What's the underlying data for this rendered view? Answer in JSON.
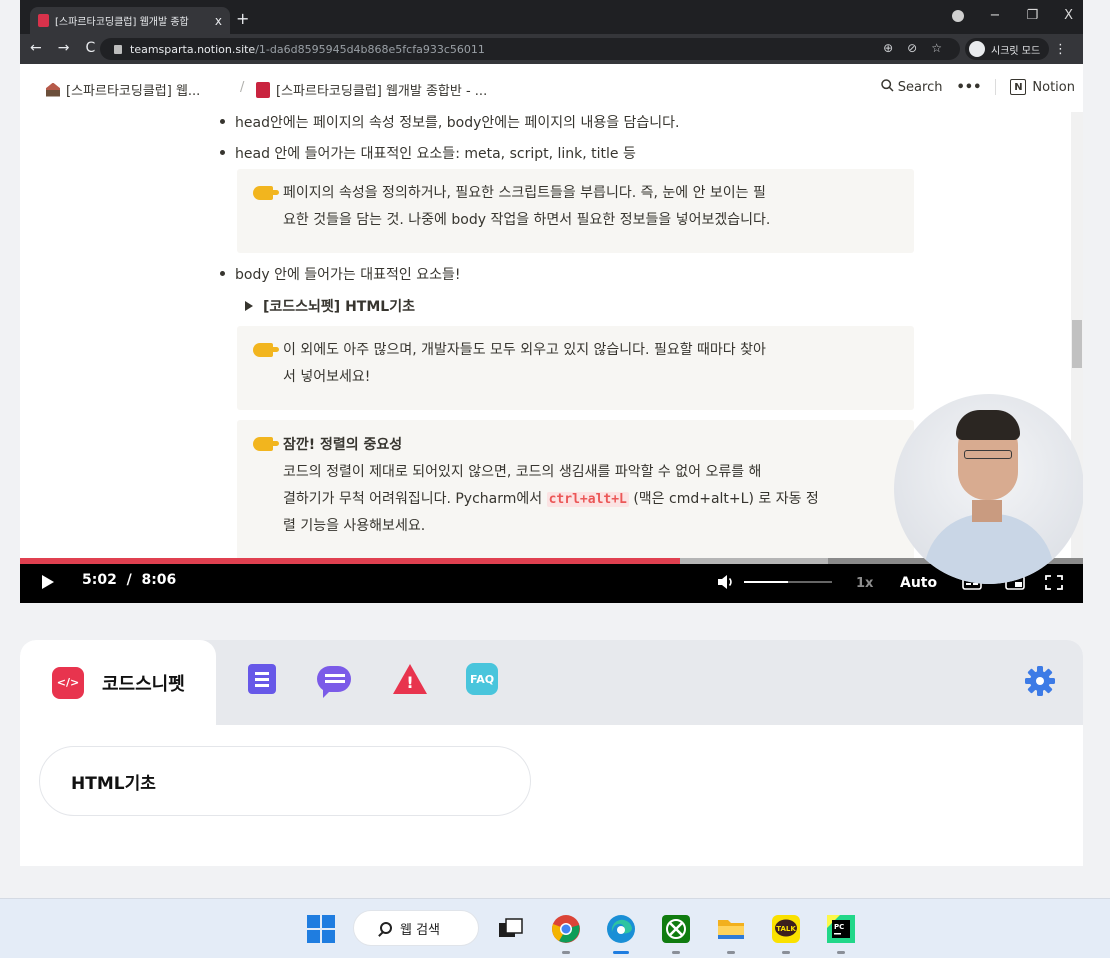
{
  "browser": {
    "tab_title": "[스파르타코딩클럽] 웹개발 종합",
    "tab_close": "x",
    "new_tab": "+",
    "url_host": "teamsparta.notion.site",
    "url_path": "/1-da6d8595945d4b868e5fcfa933c56011",
    "incognito_label": "시크릿 모드",
    "min": "−",
    "restore": "❐",
    "close": "X",
    "back": "←",
    "forward": "→",
    "reload": "C",
    "star": "☆",
    "menu": "⋮"
  },
  "notion": {
    "breadcrumb_1": "[스파르타코딩클럽] 웹...",
    "breadcrumb_sep": "/",
    "breadcrumb_2": "[스파르타코딩클럽] 웹개발 종합반 - ...",
    "search_label": "Search",
    "more": "•••",
    "brand": "Notion",
    "logo_letter": "N"
  },
  "content": {
    "bullet_1": "head안에는 페이지의 속성 정보를, body안에는 페이지의 내용을 담습니다.",
    "bullet_2": "head 안에 들어가는 대표적인 요소들: meta, script, link, title 등",
    "callout_1_line_1": "페이지의 속성을 정의하거나, 필요한 스크립트들을 부릅니다. 즉, 눈에 안 보이는 필",
    "callout_1_line_2": "요한 것들을 담는 것. 나중에 body 작업을 하면서 필요한 정보들을 넣어보겠습니다.",
    "bullet_3": "body 안에 들어가는 대표적인 요소들!",
    "toggle_label": "[코드스뇌펫] HTML기초",
    "callout_2_line_1": "이 외에도 아주 많으며, 개발자들도 모두 외우고 있지 않습니다. 필요할 때마다 찾아",
    "callout_2_line_2": "서 넣어보세요!",
    "callout_3_title": "잠깐! 정렬의 중요성",
    "callout_3_line_1": "코드의 정렬이 제대로 되어있지 않으면, 코드의 생김새를 파악할 수 없어 오류를 해",
    "callout_3_line_2_pre": "결하기가 무척 어려워집니다. Pycharm에서 ",
    "callout_3_shortcut": "ctrl+alt+L",
    "callout_3_line_2_post": " (맥은 cmd+alt+L) 로 자동 정",
    "callout_3_line_3": "렬 기능을 사용해보세요."
  },
  "player": {
    "current_time": "5:02",
    "separator": "/",
    "duration": "8:06",
    "progress_fraction": 0.621,
    "buffered_fraction": 0.76,
    "volume_fraction": 0.5,
    "speed": "1x",
    "quality": "Auto"
  },
  "panel": {
    "active_tab_label": "코드스니펫",
    "snippet_icon": "</>",
    "faq_label": "FAQ",
    "warn_mark": "!",
    "snippet_title": "HTML기초"
  },
  "taskbar": {
    "search_label": "웹 검색"
  },
  "colors": {
    "accent_red": "#e8344e",
    "purple": "#6758e8",
    "faq_cyan": "#49c5dc",
    "gear_blue": "#3d7be6",
    "progress_red": "#e04050"
  }
}
